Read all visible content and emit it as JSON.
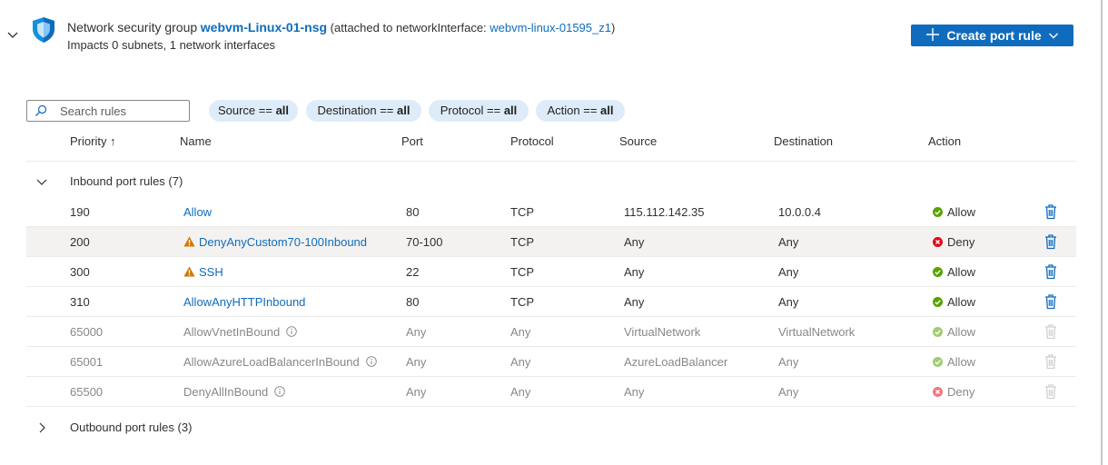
{
  "header": {
    "title_prefix": "Network security group",
    "nsg_name": "webvm-Linux-01-nsg",
    "attached_prefix": "(attached to networkInterface:",
    "nic_name": "webvm-linux-01595_z1",
    "attached_suffix": ")",
    "impacts": "Impacts 0 subnets, 1 network interfaces",
    "create_button_label": "Create port rule"
  },
  "filters": {
    "search_placeholder": "Search rules",
    "pills": [
      {
        "key": "Source",
        "op": " == ",
        "value": "all"
      },
      {
        "key": "Destination",
        "op": " == ",
        "value": "all"
      },
      {
        "key": "Protocol",
        "op": " == ",
        "value": "all"
      },
      {
        "key": "Action",
        "op": " == ",
        "value": "all"
      }
    ]
  },
  "columns": {
    "priority": "Priority ↑",
    "name": "Name",
    "port": "Port",
    "protocol": "Protocol",
    "source": "Source",
    "destination": "Destination",
    "action": "Action"
  },
  "inbound": {
    "label": "Inbound port rules (7)",
    "rules": [
      {
        "priority": "190",
        "name": "Allow",
        "port": "80",
        "protocol": "TCP",
        "source": "115.112.142.35",
        "destination": "10.0.0.4",
        "action": "Allow"
      },
      {
        "priority": "200",
        "name": "DenyAnyCustom70-100Inbound",
        "port": "70-100",
        "protocol": "TCP",
        "source": "Any",
        "destination": "Any",
        "action": "Deny"
      },
      {
        "priority": "300",
        "name": "SSH",
        "port": "22",
        "protocol": "TCP",
        "source": "Any",
        "destination": "Any",
        "action": "Allow"
      },
      {
        "priority": "310",
        "name": "AllowAnyHTTPInbound",
        "port": "80",
        "protocol": "TCP",
        "source": "Any",
        "destination": "Any",
        "action": "Allow"
      },
      {
        "priority": "65000",
        "name": "AllowVnetInBound",
        "port": "Any",
        "protocol": "Any",
        "source": "VirtualNetwork",
        "destination": "VirtualNetwork",
        "action": "Allow"
      },
      {
        "priority": "65001",
        "name": "AllowAzureLoadBalancerInBound",
        "port": "Any",
        "protocol": "Any",
        "source": "AzureLoadBalancer",
        "destination": "Any",
        "action": "Allow"
      },
      {
        "priority": "65500",
        "name": "DenyAllInBound",
        "port": "Any",
        "protocol": "Any",
        "source": "Any",
        "destination": "Any",
        "action": "Deny"
      }
    ]
  },
  "outbound": {
    "label": "Outbound port rules (3)"
  },
  "colors": {
    "link": "#0f6cbd",
    "allow": "#57a300",
    "deny": "#e00b1c",
    "warning": "#d47500",
    "pill_bg": "#deecf9",
    "selected_row": "#f3f2f1"
  }
}
